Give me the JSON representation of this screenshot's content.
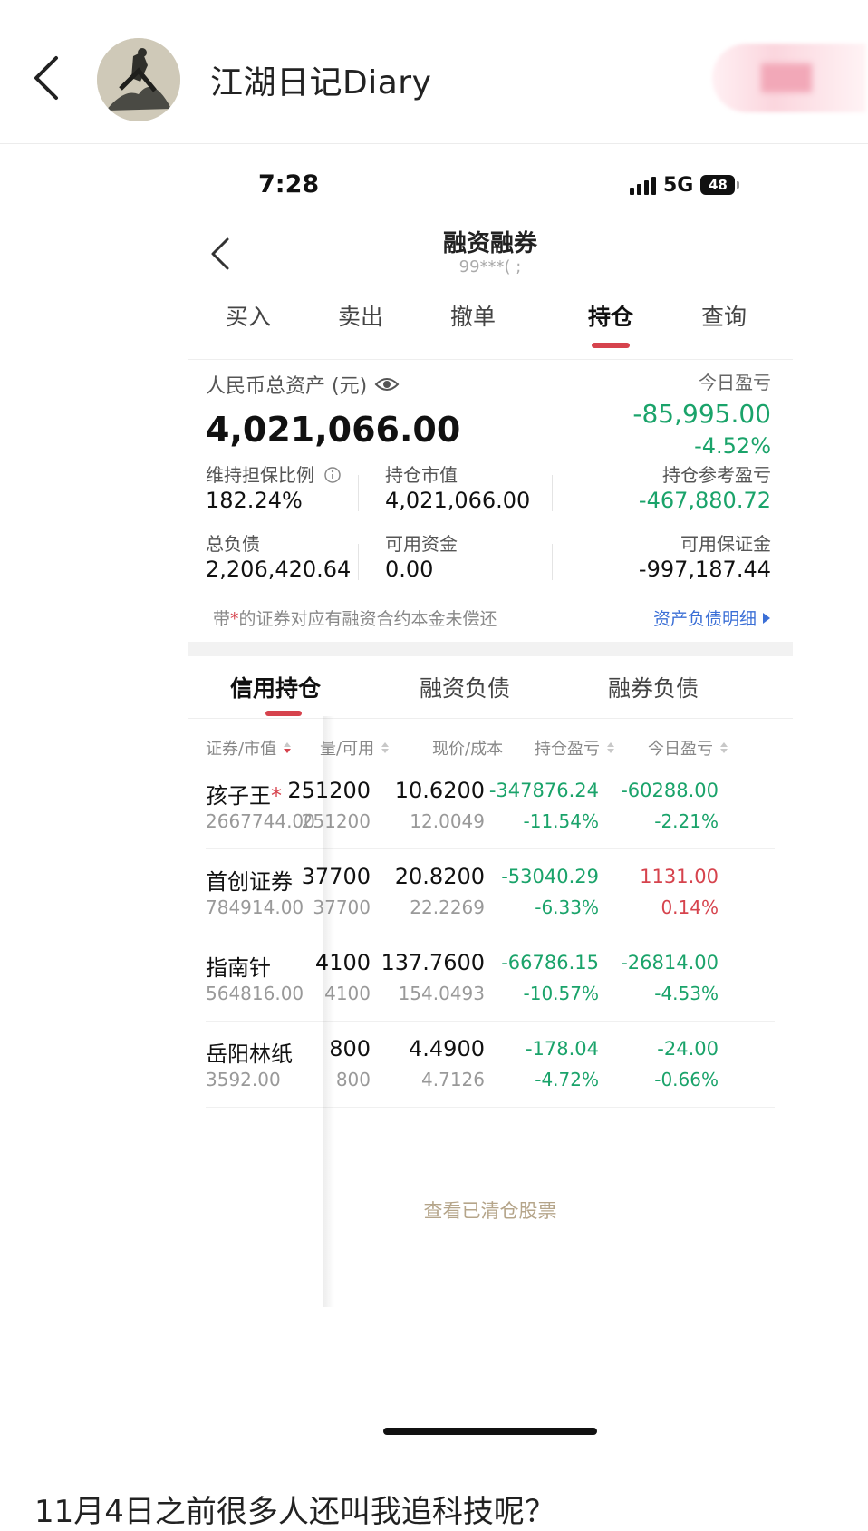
{
  "header": {
    "author_name": "江湖日记Diary",
    "follow_label": ""
  },
  "status_bar": {
    "time": "7:28",
    "network": "5G",
    "battery": "48"
  },
  "nav": {
    "title": "融资融券",
    "account": "99***( ;"
  },
  "tabs": [
    {
      "label": "买入"
    },
    {
      "label": "卖出"
    },
    {
      "label": "撤单"
    },
    {
      "label": "持仓",
      "active": true
    },
    {
      "label": "查询"
    }
  ],
  "summary": {
    "total_assets_label": "人民币总资产 (元)",
    "total_assets": "4,021,066.00",
    "today_pl_label": "今日盈亏",
    "today_pl": "-85,995.00",
    "today_pl_pct": "-4.52%",
    "maint_ratio_label": "维持担保比例",
    "maint_ratio": "182.24%",
    "position_value_label": "持仓市值",
    "position_value": "4,021,066.00",
    "position_pl_label": "持仓参考盈亏",
    "position_pl": "-467,880.72",
    "total_debt_label": "总负债",
    "total_debt": "2,206,420.64",
    "available_funds_label": "可用资金",
    "available_funds": "0.00",
    "available_margin_label": "可用保证金",
    "available_margin": "-997,187.44",
    "note_prefix": "带",
    "note_star": "*",
    "note_suffix": "的证券对应有融资合约本金未偿还",
    "detail_link": "资产负债明细"
  },
  "subtabs": [
    {
      "label": "信用持仓",
      "active": true
    },
    {
      "label": "融资负债"
    },
    {
      "label": "融券负债"
    }
  ],
  "columns": {
    "security": "证券/市值",
    "quantity": "量/可用",
    "price": "现价/成本",
    "position_pl": "持仓盈亏",
    "today_pl": "今日盈亏"
  },
  "holdings": [
    {
      "name": "孩子王",
      "star": "*",
      "market_value": "2667744.00",
      "qty": "251200",
      "available": "251200",
      "price": "10.6200",
      "cost": "12.0049",
      "pl": "-347876.24",
      "pl_pct": "-11.54%",
      "today": "-60288.00",
      "today_pct": "-2.21%"
    },
    {
      "name": "首创证券",
      "star": "",
      "market_value": "784914.00",
      "qty": "37700",
      "available": "37700",
      "price": "20.8200",
      "cost": "22.2269",
      "pl": "-53040.29",
      "pl_pct": "-6.33%",
      "today": "1131.00",
      "today_pct": "0.14%"
    },
    {
      "name": "指南针",
      "star": "",
      "market_value": "564816.00",
      "qty": "4100",
      "available": "4100",
      "price": "137.7600",
      "cost": "154.0493",
      "pl": "-66786.15",
      "pl_pct": "-10.57%",
      "today": "-26814.00",
      "today_pct": "-4.53%"
    },
    {
      "name": "岳阳林纸",
      "star": "",
      "market_value": "3592.00",
      "qty": "800",
      "available": "800",
      "price": "4.4900",
      "cost": "4.7126",
      "pl": "-178.04",
      "pl_pct": "-4.72%",
      "today": "-24.00",
      "today_pct": "-0.66%"
    }
  ],
  "cleared_link": "查看已清仓股票",
  "post_text": "11月4日之前很多人还叫我追科技呢？",
  "colors": {
    "accent_red": "#d6434d",
    "loss_green": "#1aa36a",
    "link_blue": "#3b6fd6",
    "muted_gold": "#b5a58a"
  }
}
